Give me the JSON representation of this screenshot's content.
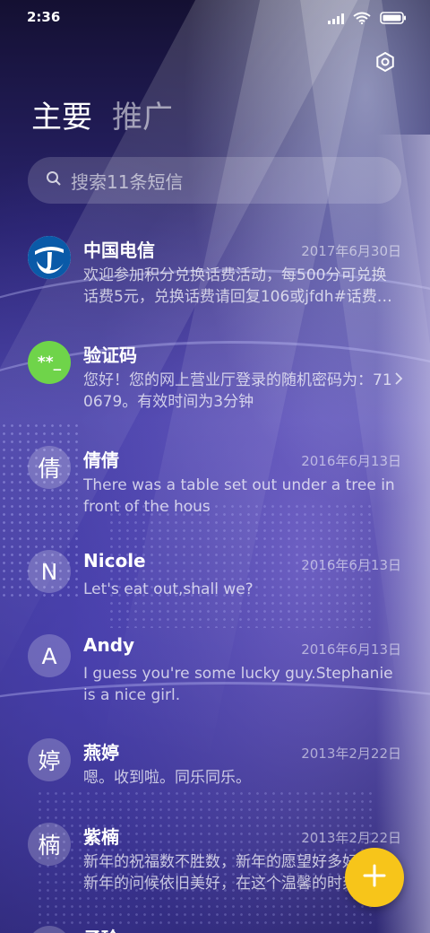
{
  "status_bar": {
    "time": "2:36",
    "signal_icon": "signal-icon",
    "wifi_icon": "wifi-icon",
    "battery_icon": "battery-icon"
  },
  "header": {
    "settings_icon": "settings-icon",
    "tabs": [
      {
        "label": "主要"
      },
      {
        "label": "推广"
      }
    ]
  },
  "search": {
    "placeholder": "搜索11条短信"
  },
  "conversations": [
    {
      "name": "中国电信",
      "date": "2017年6月30日",
      "preview": "欢迎参加积分兑换话费活动，每500分可兑换话费5元，兑换话费请回复106或jfdh#话费…",
      "avatar": "china-telecom-logo"
    },
    {
      "name": "验证码",
      "date": "",
      "preview": "您好！您的网上营业厅登录的随机密码为：710679。有效时间为3分钟",
      "avatar_text": "**_",
      "avatar_color": "#6fd44a"
    },
    {
      "name": "倩倩",
      "date": "2016年6月13日",
      "preview": "There was a table set out under a tree in front of the hous",
      "avatar_text": "倩"
    },
    {
      "name": "Nicole",
      "date": "2016年6月13日",
      "preview": "Let's eat out,shall we?",
      "avatar_text": "N"
    },
    {
      "name": "Andy",
      "date": "2016年6月13日",
      "preview": "I guess you're some lucky guy.Stephanie is a nice girl.",
      "avatar_text": "A"
    },
    {
      "name": "燕婷",
      "date": "2013年2月22日",
      "preview": "嗯。收到啦。同乐同乐。",
      "avatar_text": "婷"
    },
    {
      "name": "紫楠",
      "date": "2013年2月22日",
      "preview": "新年的祝福数不胜数，新年的愿望好多好多，新年的问候依旧美好，在这个温馨的时刻",
      "avatar_text": "楠"
    },
    {
      "name": "子玲",
      "date": "",
      "preview": "",
      "avatar_text": ""
    }
  ],
  "fab": {
    "icon": "plus-icon"
  },
  "colors": {
    "accent": "#f7c51a",
    "verify_green": "#6fd44a",
    "telecom_blue": "#0a5aa8"
  }
}
